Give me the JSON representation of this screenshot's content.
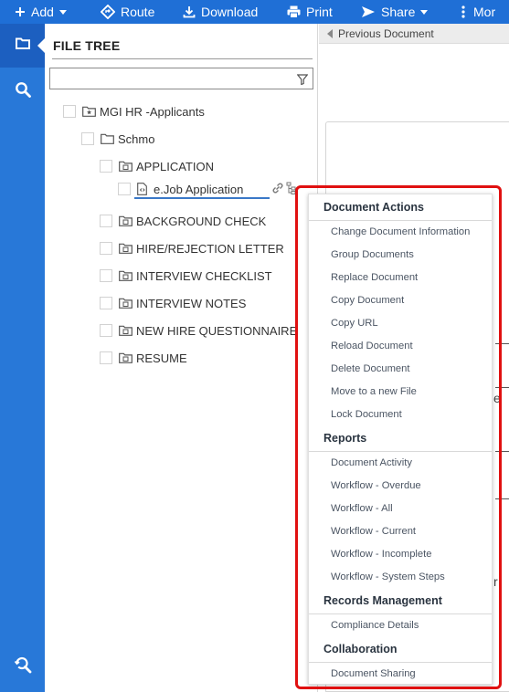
{
  "toolbar": {
    "add_label": "Add",
    "route_label": "Route",
    "download_label": "Download",
    "print_label": "Print",
    "share_label": "Share",
    "more_label": "Mor"
  },
  "panel": {
    "title": "FILE TREE",
    "filter_placeholder": ""
  },
  "tree": {
    "root": "MGI HR -Applicants",
    "folder": "Schmo",
    "items": [
      "APPLICATION",
      "e.Job Application",
      "BACKGROUND CHECK",
      "HIRE/REJECTION LETTER",
      "INTERVIEW CHECKLIST",
      "INTERVIEW NOTES",
      "NEW HIRE QUESTIONNAIRE",
      "RESUME"
    ]
  },
  "content": {
    "prev_label": "Previous Document",
    "edge_chars": [
      "e",
      "r"
    ]
  },
  "menu": {
    "doc_actions_heading": "Document Actions",
    "doc_actions": [
      "Change Document Information",
      "Group Documents",
      "Replace Document",
      "Copy Document",
      "Copy URL",
      "Reload Document",
      "Delete Document",
      "Move to a new File",
      "Lock Document"
    ],
    "reports_heading": "Reports",
    "reports": [
      "Document Activity",
      "Workflow - Overdue",
      "Workflow - All",
      "Workflow - Current",
      "Workflow - Incomplete",
      "Workflow - System Steps"
    ],
    "records_heading": "Records Management",
    "records": [
      "Compliance Details"
    ],
    "collab_heading": "Collaboration",
    "collab": [
      "Document Sharing"
    ]
  },
  "colors": {
    "toolbar_blue": "#1f6fd6",
    "rail_blue": "#2878d8",
    "rail_active": "#1c5fc0",
    "highlight_red": "#e01010"
  },
  "icons": {
    "add": "plus-icon",
    "route": "route-diamond-icon",
    "download": "download-icon",
    "print": "printer-icon",
    "share": "share-arrow-icon",
    "more": "vertical-ellipsis-icon",
    "rail_folder": "folder-icon",
    "rail_search": "search-icon",
    "rail_bottom": "search-refresh-icon",
    "filter": "funnel-icon",
    "tree_root": "starred-folder-icon",
    "tree_folder": "folder-icon",
    "tree_doc": "document-icon",
    "row_link": "link-icon",
    "row_tree": "hierarchy-icon"
  }
}
